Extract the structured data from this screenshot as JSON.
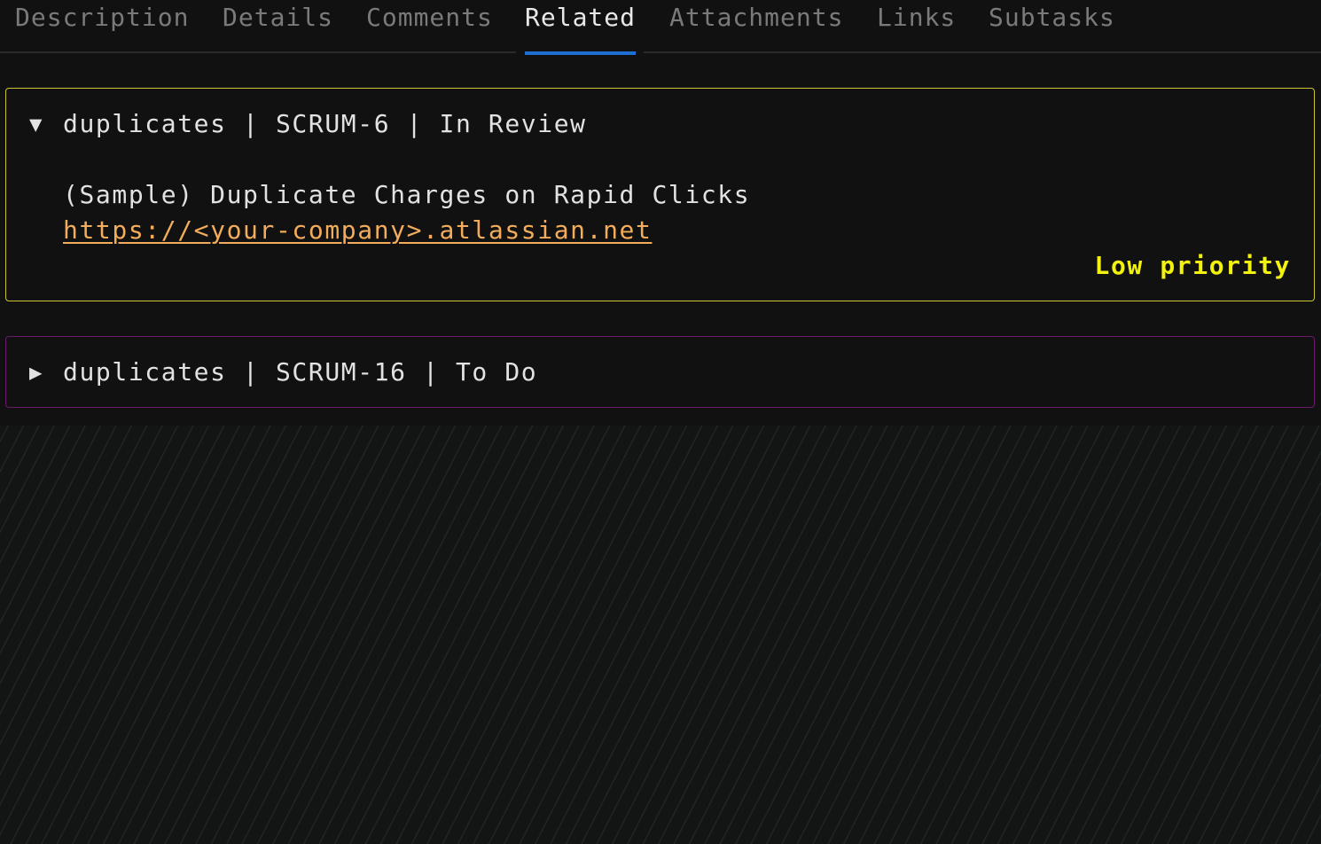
{
  "tabs": [
    {
      "label": "Description",
      "active": false
    },
    {
      "label": "Details",
      "active": false
    },
    {
      "label": "Comments",
      "active": false
    },
    {
      "label": "Related",
      "active": true
    },
    {
      "label": "Attachments",
      "active": false
    },
    {
      "label": "Links",
      "active": false
    },
    {
      "label": "Subtasks",
      "active": false
    }
  ],
  "related": [
    {
      "expanded": true,
      "disclosure_icon": "triangle-down-icon",
      "disclosure_glyph": "▼",
      "header": "duplicates | SCRUM-6 | In Review",
      "title": "(Sample) Duplicate Charges on Rapid Clicks",
      "link": "https://<your-company>.atlassian.net",
      "priority": "Low priority",
      "border_color": "#c9c630"
    },
    {
      "expanded": false,
      "disclosure_icon": "triangle-right-icon",
      "disclosure_glyph": "▶",
      "header": "duplicates | SCRUM-16 | To Do",
      "border_color": "#6a1a6a"
    }
  ],
  "colors": {
    "background": "#111111",
    "active_tab_indicator": "#1e6fd1",
    "link": "#f2ac5c",
    "priority_low": "#f2f20e"
  }
}
